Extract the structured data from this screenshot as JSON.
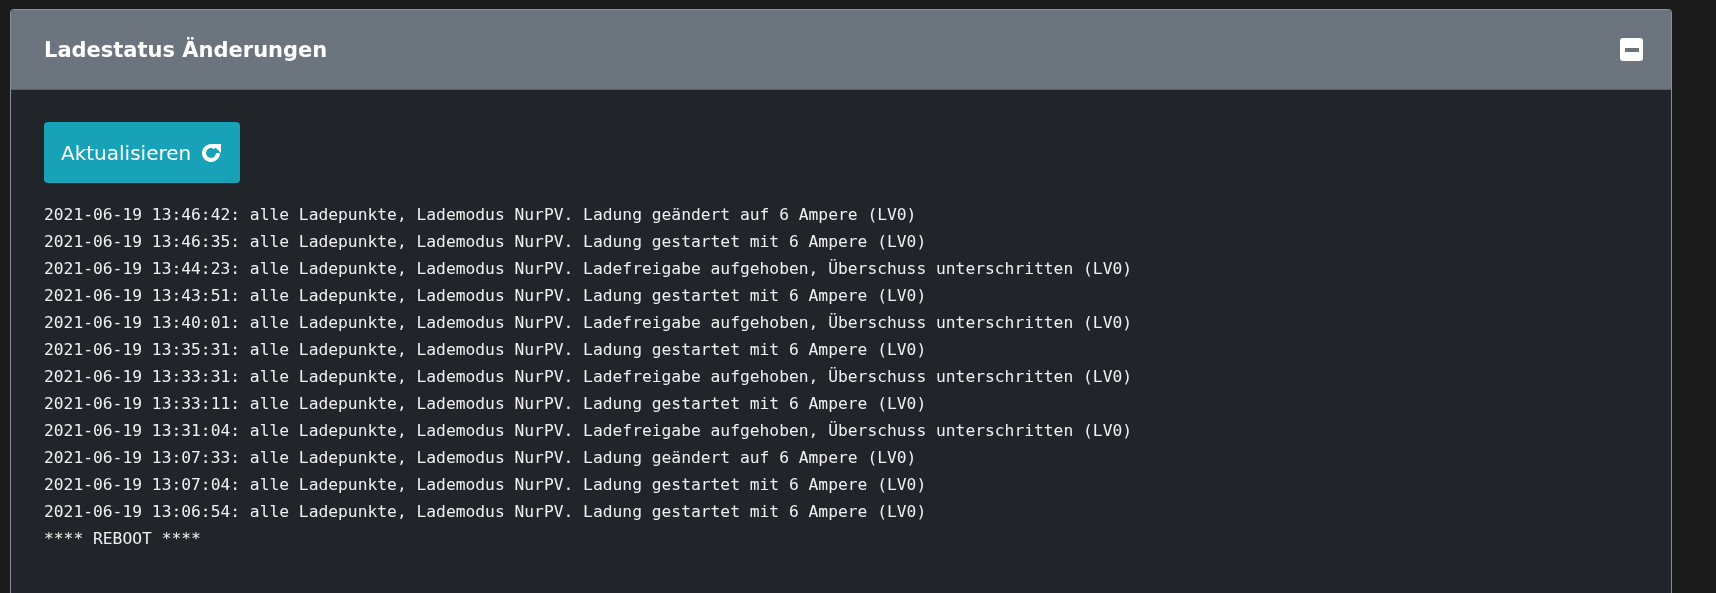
{
  "card": {
    "title": "Ladestatus Änderungen",
    "collapse_button": {
      "expanded": true
    },
    "refresh_button": "Aktualisieren",
    "log_lines": [
      "2021-06-19 13:46:42: alle Ladepunkte, Lademodus NurPV. Ladung geändert auf 6 Ampere (LV0)",
      "2021-06-19 13:46:35: alle Ladepunkte, Lademodus NurPV. Ladung gestartet mit 6 Ampere (LV0)",
      "2021-06-19 13:44:23: alle Ladepunkte, Lademodus NurPV. Ladefreigabe aufgehoben, Überschuss unterschritten (LV0)",
      "2021-06-19 13:43:51: alle Ladepunkte, Lademodus NurPV. Ladung gestartet mit 6 Ampere (LV0)",
      "2021-06-19 13:40:01: alle Ladepunkte, Lademodus NurPV. Ladefreigabe aufgehoben, Überschuss unterschritten (LV0)",
      "2021-06-19 13:35:31: alle Ladepunkte, Lademodus NurPV. Ladung gestartet mit 6 Ampere (LV0)",
      "2021-06-19 13:33:31: alle Ladepunkte, Lademodus NurPV. Ladefreigabe aufgehoben, Überschuss unterschritten (LV0)",
      "2021-06-19 13:33:11: alle Ladepunkte, Lademodus NurPV. Ladung gestartet mit 6 Ampere (LV0)",
      "2021-06-19 13:31:04: alle Ladepunkte, Lademodus NurPV. Ladefreigabe aufgehoben, Überschuss unterschritten (LV0)",
      "2021-06-19 13:07:33: alle Ladepunkte, Lademodus NurPV. Ladung geändert auf 6 Ampere (LV0)",
      "2021-06-19 13:07:04: alle Ladepunkte, Lademodus NurPV. Ladung gestartet mit 6 Ampere (LV0)",
      "2021-06-19 13:06:54: alle Ladepunkte, Lademodus NurPV. Ladung gestartet mit 6 Ampere (LV0)",
      "**** REBOOT ****"
    ]
  }
}
